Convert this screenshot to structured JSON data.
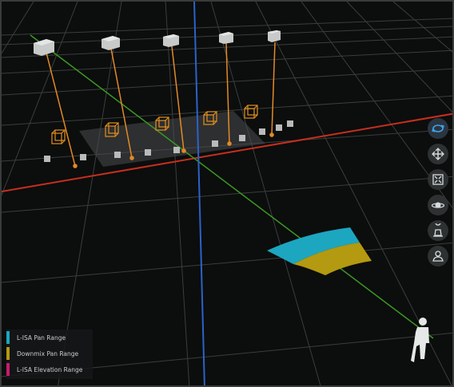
{
  "legend": {
    "items": [
      {
        "label": "L-ISA Pan Range",
        "color": "#1da6c0"
      },
      {
        "label": "Downmix Pan Range",
        "color": "#b39a10"
      },
      {
        "label": "L-ISA Elevation Range",
        "color": "#c51d6a"
      }
    ]
  },
  "toolbar": {
    "buttons": [
      {
        "icon": "rotate-icon",
        "active": true
      },
      {
        "icon": "move-icon",
        "active": false
      },
      {
        "icon": "fit-view-icon",
        "active": false
      },
      {
        "icon": "orbit-view-icon",
        "active": false
      },
      {
        "icon": "listener-position-icon",
        "active": false
      },
      {
        "icon": "listener-view-icon",
        "active": false
      }
    ]
  },
  "colors": {
    "background": "#0c0d0d",
    "grid": "#3d4040",
    "x_axis": "#c62f1e",
    "y_axis": "#2a63c9",
    "z_axis": "#3a9a22",
    "speaker_link": "#e28a25",
    "source_box": "#e2901d"
  }
}
